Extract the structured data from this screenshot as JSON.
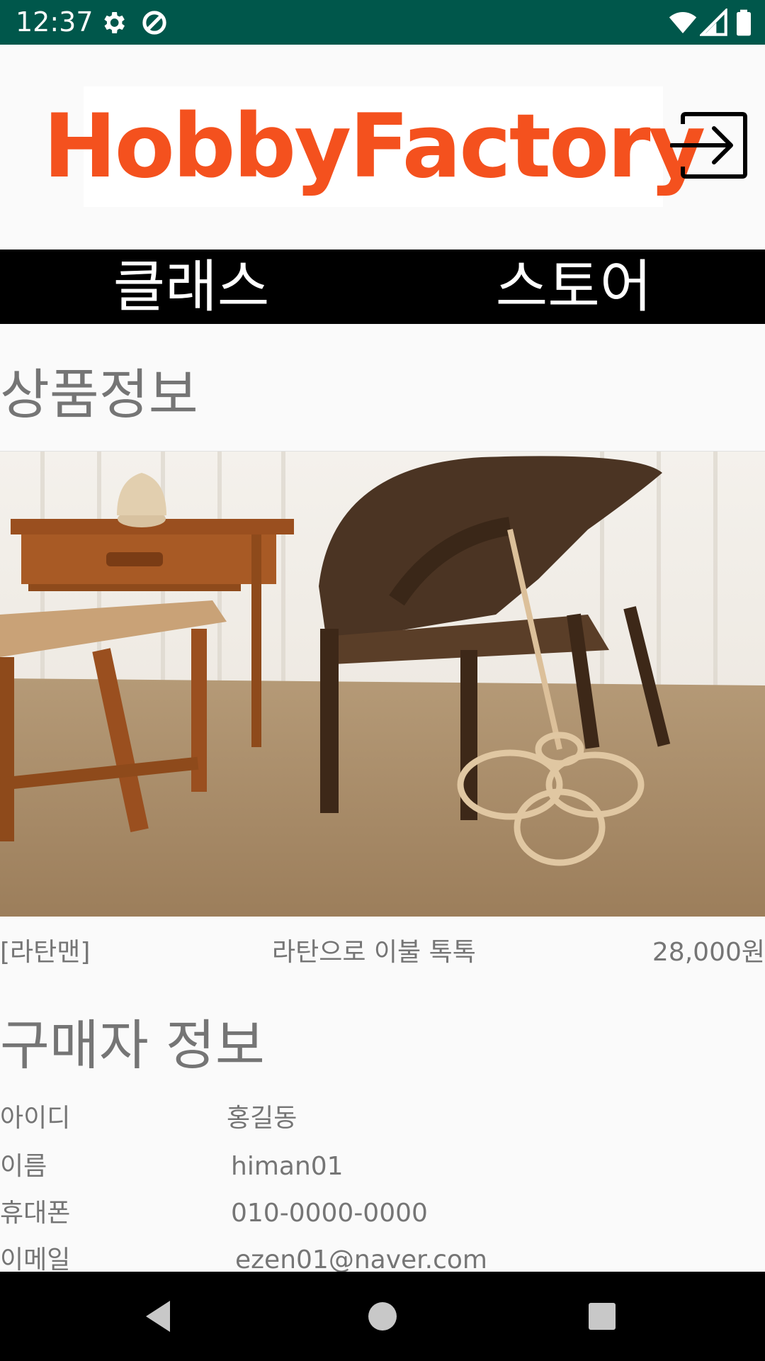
{
  "status_bar": {
    "time": "12:37",
    "icons": [
      "gear-icon",
      "data-saver-icon",
      "wifi-icon",
      "signal-icon",
      "battery-icon"
    ]
  },
  "header": {
    "logo_text": "HobbyFactory",
    "login_icon": "login-icon"
  },
  "tabs": [
    {
      "label": "클래스"
    },
    {
      "label": "스토어"
    }
  ],
  "product_section": {
    "title": "상품정보",
    "brand": "[라탄맨]",
    "name": "라탄으로 이불 톡톡",
    "price": "28,000원"
  },
  "buyer_section": {
    "title": "구매자 정보",
    "rows": [
      {
        "label": "아이디",
        "value": "홍길동"
      },
      {
        "label": "이름",
        "value": "himan01"
      },
      {
        "label": "휴대폰",
        "value": "010-0000-0000"
      },
      {
        "label": "이메일",
        "value": "ezen01@naver.com"
      }
    ]
  },
  "colors": {
    "status_bar": "#00574b",
    "logo": "#f4511e",
    "tab_bar": "#000000",
    "muted_text": "#757575"
  }
}
